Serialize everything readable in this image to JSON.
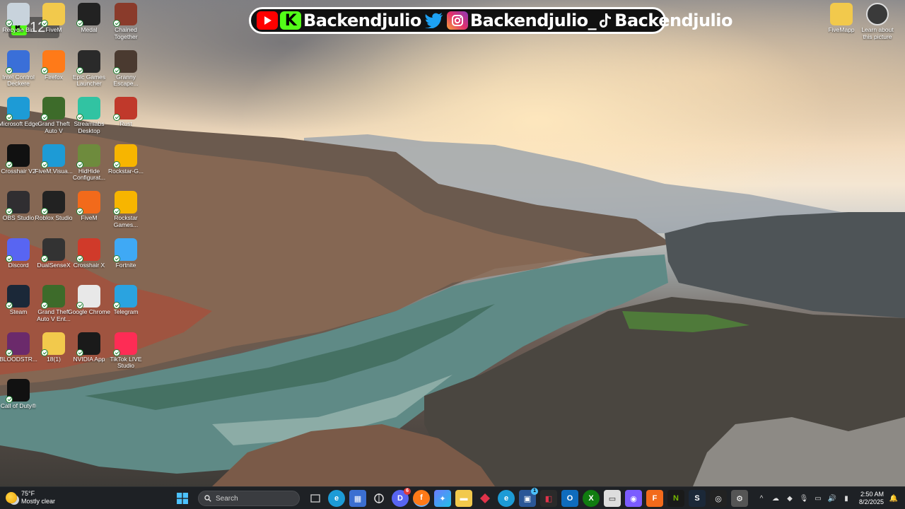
{
  "banner": {
    "youtube_handle": "Backendjulio",
    "twitter_handle": "Backendjulio",
    "instagram_handle": "Backendjulio_",
    "tiktok_handle": "Backendjulio"
  },
  "stream_counter": {
    "count": "12"
  },
  "desktop_icons": [
    {
      "label": "Recycle Bin",
      "icon": "recycle-bin-icon",
      "color": "#c8d3dc"
    },
    {
      "label": "FiveM",
      "icon": "folder-icon",
      "color": "#f2c94c"
    },
    {
      "label": "Medal",
      "icon": "medal-icon",
      "color": "#222222"
    },
    {
      "label": "Chained Together",
      "icon": "game-icon",
      "color": "#8a3b2b"
    },
    {
      "label": "Intel Control Deckere",
      "icon": "intel-icon",
      "color": "#3a6fd8"
    },
    {
      "label": "Firefox",
      "icon": "firefox-icon",
      "color": "#ff7a18"
    },
    {
      "label": "Epic Games Launcher",
      "icon": "epic-games-icon",
      "color": "#2a2a2a"
    },
    {
      "label": "Granny Escape...",
      "icon": "game-icon",
      "color": "#4a3a30"
    },
    {
      "label": "Microsoft Edge",
      "icon": "edge-icon",
      "color": "#1d9bd6"
    },
    {
      "label": "Grand Theft Auto V",
      "icon": "gta-icon",
      "color": "#3d6b2a"
    },
    {
      "label": "Streamlabs Desktop",
      "icon": "streamlabs-icon",
      "color": "#31c3a2"
    },
    {
      "label": "Rust",
      "icon": "rust-icon",
      "color": "#c0392b"
    },
    {
      "label": "Crosshair V2",
      "icon": "crosshair-icon",
      "color": "#111111"
    },
    {
      "label": "FiveM.Visua...",
      "icon": "edge-icon",
      "color": "#1d9bd6"
    },
    {
      "label": "HidHide Configurat...",
      "icon": "hidhide-icon",
      "color": "#6e8b3d"
    },
    {
      "label": "Rockstar-G...",
      "icon": "rockstar-icon",
      "color": "#f7b500"
    },
    {
      "label": "OBS Studio",
      "icon": "obs-icon",
      "color": "#302e31"
    },
    {
      "label": "Roblox Studio",
      "icon": "roblox-icon",
      "color": "#222222"
    },
    {
      "label": "FiveM",
      "icon": "fivem-icon",
      "color": "#f26a1b"
    },
    {
      "label": "Rockstar Games...",
      "icon": "rockstar-icon",
      "color": "#f7b500"
    },
    {
      "label": "Discord",
      "icon": "discord-icon",
      "color": "#5865f2"
    },
    {
      "label": "DualSenseX",
      "icon": "dualsense-icon",
      "color": "#333333"
    },
    {
      "label": "Crosshair X",
      "icon": "crosshair-icon",
      "color": "#d03a2a"
    },
    {
      "label": "Fortnite",
      "icon": "fortnite-icon",
      "color": "#3fa9f5"
    },
    {
      "label": "Steam",
      "icon": "steam-icon",
      "color": "#1b2838"
    },
    {
      "label": "Grand Theft Auto V Ent...",
      "icon": "gta-icon",
      "color": "#3d6b2a"
    },
    {
      "label": "Google Chrome",
      "icon": "chrome-icon",
      "color": "#e8e8e8"
    },
    {
      "label": "Telegram",
      "icon": "telegram-icon",
      "color": "#2aa3e0"
    },
    {
      "label": "BLOODSTR...",
      "icon": "game-icon",
      "color": "#6b2a6b"
    },
    {
      "label": "18(1)",
      "icon": "folder-icon",
      "color": "#f2c94c"
    },
    {
      "label": "NVIDIA App",
      "icon": "nvidia-icon",
      "color": "#1a1a1a"
    },
    {
      "label": "TikTok LIVE Studio",
      "icon": "tiktok-icon",
      "color": "#fe2c55"
    },
    {
      "label": "Call of Duty®",
      "icon": "cod-icon",
      "color": "#111111"
    }
  ],
  "right_icons": [
    {
      "label": "FiveMapp",
      "icon": "folder-icon",
      "color": "#f2c94c"
    },
    {
      "label": "Learn about this picture",
      "icon": "learn-picture-icon",
      "color": "#3a3a3a"
    }
  ],
  "taskbar": {
    "weather_temp": "75°F",
    "weather_desc": "Mostly clear",
    "search_placeholder": "Search",
    "discord_badge": "6",
    "app_badge": "1",
    "time": "2:50 AM",
    "date": "8/2/2025"
  }
}
